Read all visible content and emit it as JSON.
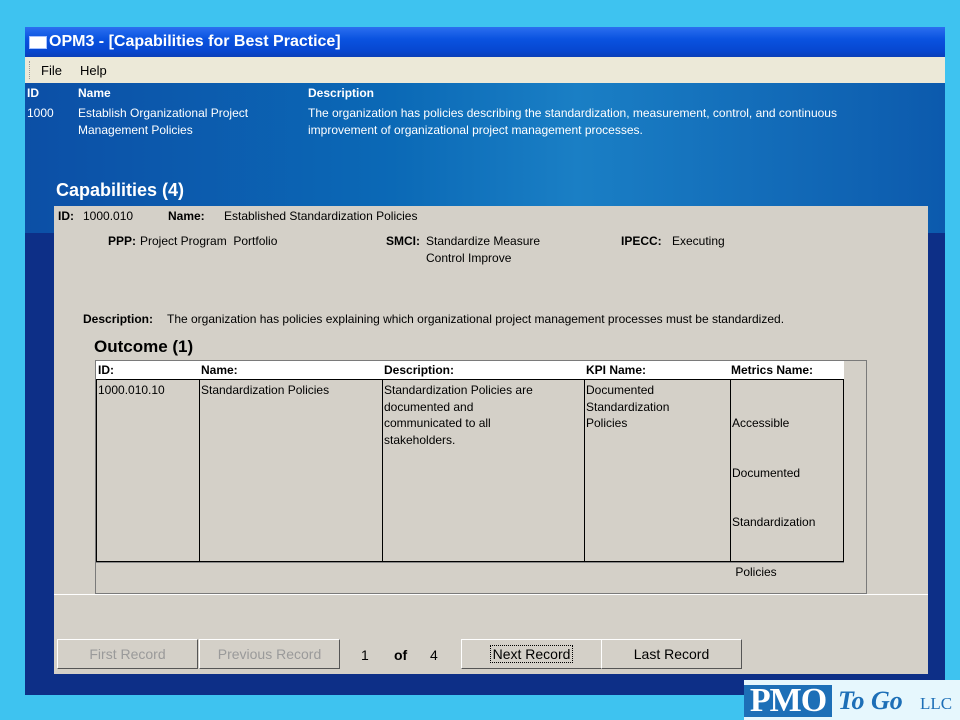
{
  "window": {
    "title": "OPM3 - [Capabilities for Best Practice]"
  },
  "menu": {
    "file": "File",
    "help": "Help"
  },
  "best_practice": {
    "id_header": "ID",
    "name_header": "Name",
    "description_header": "Description",
    "id": "1000",
    "name_line1": "Establish Organizational Project",
    "name_line2": "Management Policies",
    "description_line1": "The organization has policies describing the standardization, measurement, control, and continuous",
    "description_line2": "improvement of organizational project management processes."
  },
  "capabilities_title": "Capabilities (4)",
  "capability": {
    "id_label": "ID:",
    "id": "1000.010",
    "name_label": "Name:",
    "name": "Established Standardization Policies",
    "ppp_label": "PPP:",
    "ppp": "Project Program  Portfolio",
    "smci_label": "SMCI:",
    "smci_line1": "Standardize Measure",
    "smci_line2": "Control Improve",
    "ipecc_label": "IPECC:",
    "ipecc": "Executing",
    "description_label": "Description:",
    "description": "The organization has policies explaining which organizational project management processes must be standardized."
  },
  "outcome": {
    "title": "Outcome (1)",
    "headers": {
      "id": "ID:",
      "name": "Name:",
      "description": "Description:",
      "kpi": "KPI Name:",
      "metrics": "Metrics Name:"
    },
    "row": {
      "id": "1000.010.10",
      "name": "Standardization Policies",
      "description": [
        "Standardization Policies are",
        "documented and",
        "communicated to all",
        "stakeholders."
      ],
      "kpi": [
        "Documented",
        "Standardization",
        "Policies"
      ],
      "metrics": [
        "Accessible",
        "Documented",
        "Standardization",
        " Policies"
      ]
    }
  },
  "navigation": {
    "first": "First Record",
    "previous": "Previous Record",
    "current": "1",
    "of": "of",
    "total": "4",
    "next": "Next Record",
    "last": "Last Record"
  },
  "logo": {
    "pmo": "PMO",
    "togo": "To Go",
    "llc": "LLC"
  }
}
